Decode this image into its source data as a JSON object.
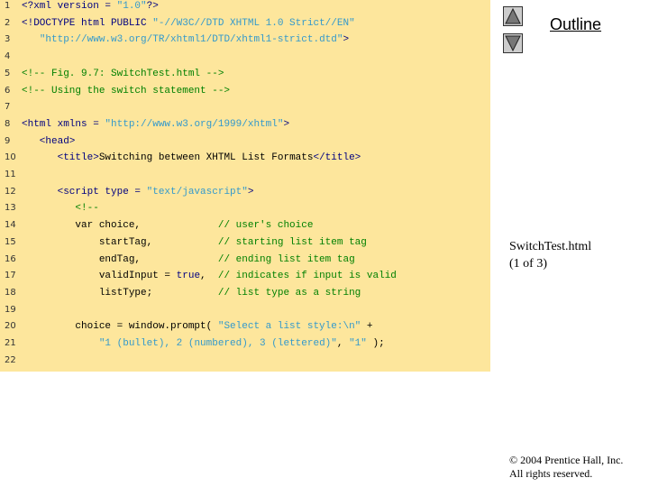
{
  "code_lines": [
    [
      [
        "<?xml version = ",
        "t"
      ],
      [
        "\"1.0\"",
        "s"
      ],
      [
        "?>",
        "t"
      ]
    ],
    [
      [
        "<!DOCTYPE html PUBLIC ",
        "t"
      ],
      [
        "\"-//W3C//DTD XHTML 1.0 Strict//EN\"",
        "s"
      ]
    ],
    [
      [
        "   ",
        "p"
      ],
      [
        "\"http://www.w3.org/TR/xhtml1/DTD/xhtml1-strict.dtd\"",
        "s"
      ],
      [
        ">",
        "t"
      ]
    ],
    [],
    [
      [
        "<!-- Fig. 9.7: SwitchTest.html -->",
        "c"
      ]
    ],
    [
      [
        "<!-- Using the switch statement -->",
        "c"
      ]
    ],
    [],
    [
      [
        "<html xmlns = ",
        "t"
      ],
      [
        "\"http://www.w3.org/1999/xhtml\"",
        "s"
      ],
      [
        ">",
        "t"
      ]
    ],
    [
      [
        "   <head>",
        "t"
      ]
    ],
    [
      [
        "      <title>",
        "t"
      ],
      [
        "Switching between XHTML List Formats",
        "p"
      ],
      [
        "</title>",
        "t"
      ]
    ],
    [],
    [
      [
        "      <script type = ",
        "t"
      ],
      [
        "\"text/javascript\"",
        "s"
      ],
      [
        ">",
        "t"
      ]
    ],
    [
      [
        "         <!--",
        "c"
      ]
    ],
    [
      [
        "         var choice,             ",
        "p"
      ],
      [
        "// user's choice",
        "c"
      ]
    ],
    [
      [
        "             startTag,           ",
        "p"
      ],
      [
        "// starting list item tag",
        "c"
      ]
    ],
    [
      [
        "             endTag,             ",
        "p"
      ],
      [
        "// ending list item tag",
        "c"
      ]
    ],
    [
      [
        "             validInput = ",
        "p"
      ],
      [
        "true",
        "t"
      ],
      [
        ",  ",
        "p"
      ],
      [
        "// indicates if input is valid",
        "c"
      ]
    ],
    [
      [
        "             listType;           ",
        "p"
      ],
      [
        "// list type as a string",
        "c"
      ]
    ],
    [],
    [
      [
        "         choice = window.prompt( ",
        "p"
      ],
      [
        "\"Select a list style:\\n\"",
        "s"
      ],
      [
        " +",
        "p"
      ]
    ],
    [
      [
        "             ",
        "p"
      ],
      [
        "\"1 (bullet), 2 (numbered), 3 (lettered)\"",
        "s"
      ],
      [
        ", ",
        "p"
      ],
      [
        "\"1\"",
        "s"
      ],
      [
        " );",
        "p"
      ]
    ],
    []
  ],
  "sidebar": {
    "outline_label": "Outline",
    "file_name": "SwitchTest.html",
    "page": "(1 of 3)",
    "copyright": "© 2004 Prentice Hall, Inc.",
    "rights": "All rights reserved."
  },
  "icons": {
    "prev": "triangle-up-icon",
    "next": "triangle-down-icon"
  }
}
